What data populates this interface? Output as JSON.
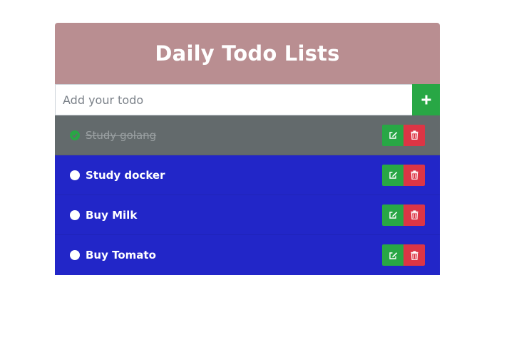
{
  "header": {
    "title": "Daily Todo Lists"
  },
  "input": {
    "placeholder": "Add your todo",
    "value": "",
    "add_icon": "plus-icon"
  },
  "todos": [
    {
      "text": "Study golang",
      "done": true
    },
    {
      "text": "Study docker",
      "done": false
    },
    {
      "text": "Buy Milk",
      "done": false
    },
    {
      "text": "Buy Tomato",
      "done": false
    }
  ],
  "icons": {
    "edit": "edit-icon",
    "delete": "trash-icon",
    "done": "check-circle-icon",
    "pending": "circle-icon"
  },
  "colors": {
    "header": "#b98e91",
    "done_row": "#636a6c",
    "pending_row": "#2226c8",
    "edit_button": "#28a745",
    "delete_button": "#dc3545",
    "add_button": "#28a745"
  }
}
